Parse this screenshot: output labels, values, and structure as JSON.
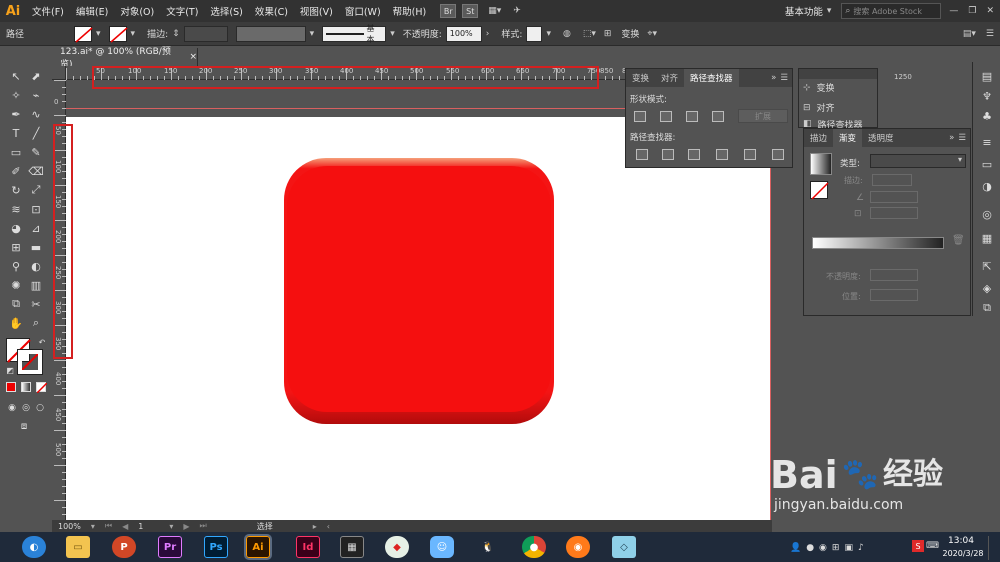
{
  "menubar": {
    "logo": "Ai",
    "items": [
      "文件(F)",
      "编辑(E)",
      "对象(O)",
      "文字(T)",
      "选择(S)",
      "效果(C)",
      "视图(V)",
      "窗口(W)",
      "帮助(H)"
    ],
    "bridge": "Br",
    "stock": "St",
    "workspace": "基本功能",
    "search_placeholder": "搜索 Adobe Stock"
  },
  "controlbar": {
    "selection_label": "路径",
    "stroke_label": "描边:",
    "brush_label": "基本",
    "opacity_label": "不透明度:",
    "opacity_value": "100%",
    "style_label": "样式:",
    "transform_label": "变换"
  },
  "document": {
    "tab_title": "123.ai* @ 100% (RGB/预览)",
    "close_label": "×"
  },
  "ruler": {
    "h_ticks": [
      "50",
      "100",
      "150",
      "200",
      "250",
      "300",
      "350",
      "400",
      "450",
      "500",
      "550",
      "600",
      "650",
      "700",
      "750",
      "800",
      "850",
      "1250"
    ],
    "v_ticks": [
      "0",
      "50",
      "100",
      "150",
      "200",
      "250",
      "300",
      "350",
      "400",
      "450",
      "500"
    ]
  },
  "pathfinder_panel": {
    "tabs": [
      "变换",
      "对齐",
      "路径查找器"
    ],
    "shape_modes_label": "形状模式:",
    "expand_label": "扩展",
    "pathfinders_label": "路径查找器:"
  },
  "transform_panel": {
    "items": [
      "变换",
      "对齐",
      "路径查找器"
    ]
  },
  "gradient_panel": {
    "tabs": [
      "描边",
      "渐变",
      "透明度"
    ],
    "type_label": "类型:",
    "stroke_label": "描边:",
    "opacity_label": "不透明度:",
    "position_label": "位置:"
  },
  "statusbar": {
    "zoom": "100%",
    "page": "1",
    "mode": "选择"
  },
  "taskbar": {
    "icons": [
      "browser-icon",
      "explorer-icon",
      "powerpoint-icon",
      "premiere-icon",
      "photoshop-icon",
      "illustrator-icon",
      "indesign-icon",
      "media-icon",
      "app-icon",
      "chat-icon",
      "qq-icon",
      "chrome-icon",
      "firefox-icon",
      "notes-icon"
    ],
    "premiere": "Pr",
    "photoshop": "Ps",
    "illustrator": "Ai",
    "indesign": "Id",
    "time": "13:04",
    "date": "2020/3/28"
  },
  "watermark": {
    "brand": "Bai",
    "brand_suffix": "经验",
    "url": "jingyan.baidu.com"
  },
  "colors": {
    "accent": "#f50f0f",
    "highlight": "#d42020",
    "ai_orange": "#f7a21b"
  }
}
